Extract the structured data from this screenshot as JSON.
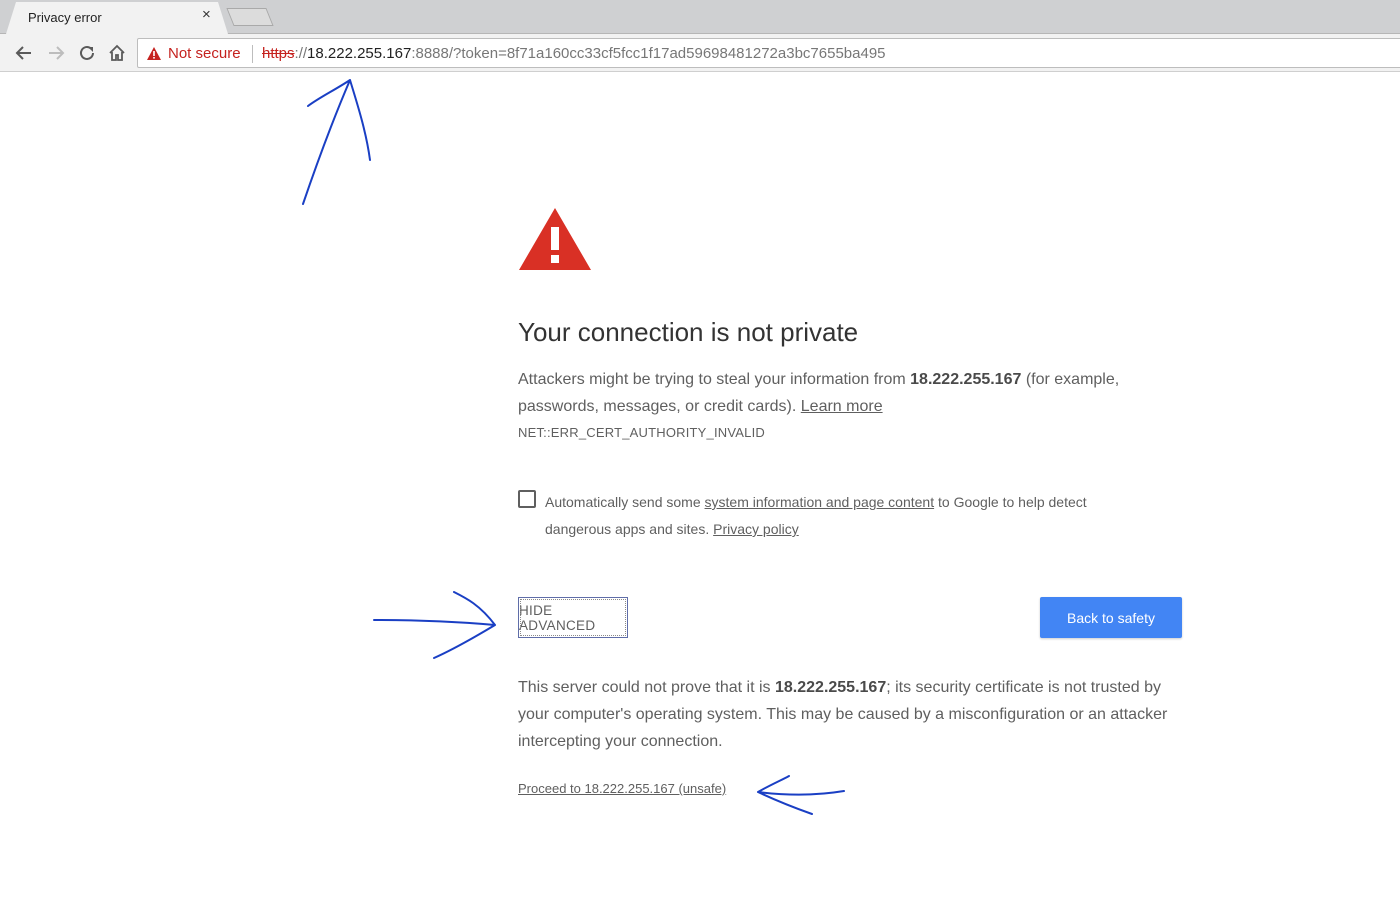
{
  "tab": {
    "title": "Privacy error",
    "close": "×"
  },
  "omnibox": {
    "security_label": "Not secure",
    "url_scheme": "https",
    "url_sep": "://",
    "url_host": "18.222.255.167",
    "url_rest": ":8888/?token=8f71a160cc33cf5fcc1f17ad59698481272a3bc7655ba495"
  },
  "interstitial": {
    "heading": "Your connection is not private",
    "explain_pre": "Attackers might be trying to steal your information from ",
    "explain_host": "18.222.255.167",
    "explain_post": " (for example, passwords, messages, or credit cards). ",
    "learn_more": "Learn more",
    "error_code": "NET::ERR_CERT_AUTHORITY_INVALID",
    "optin_pre": "Automatically send some ",
    "optin_link": "system information and page content",
    "optin_post": " to Google to help detect dangerous apps and sites. ",
    "privacy_policy": "Privacy policy",
    "hide_advanced": "HIDE ADVANCED",
    "back_to_safety": "Back to safety",
    "details_pre": "This server could not prove that it is ",
    "details_host": "18.222.255.167",
    "details_post": "; its security certificate is not trusted by your computer's operating system. This may be caused by a misconfiguration or an attacker intercepting your connection.",
    "proceed_link": "Proceed to 18.222.255.167 (unsafe)"
  },
  "colors": {
    "warning_red": "#d93025",
    "primary_button": "#4285f4",
    "annotation_ink": "#1a3fc4"
  }
}
